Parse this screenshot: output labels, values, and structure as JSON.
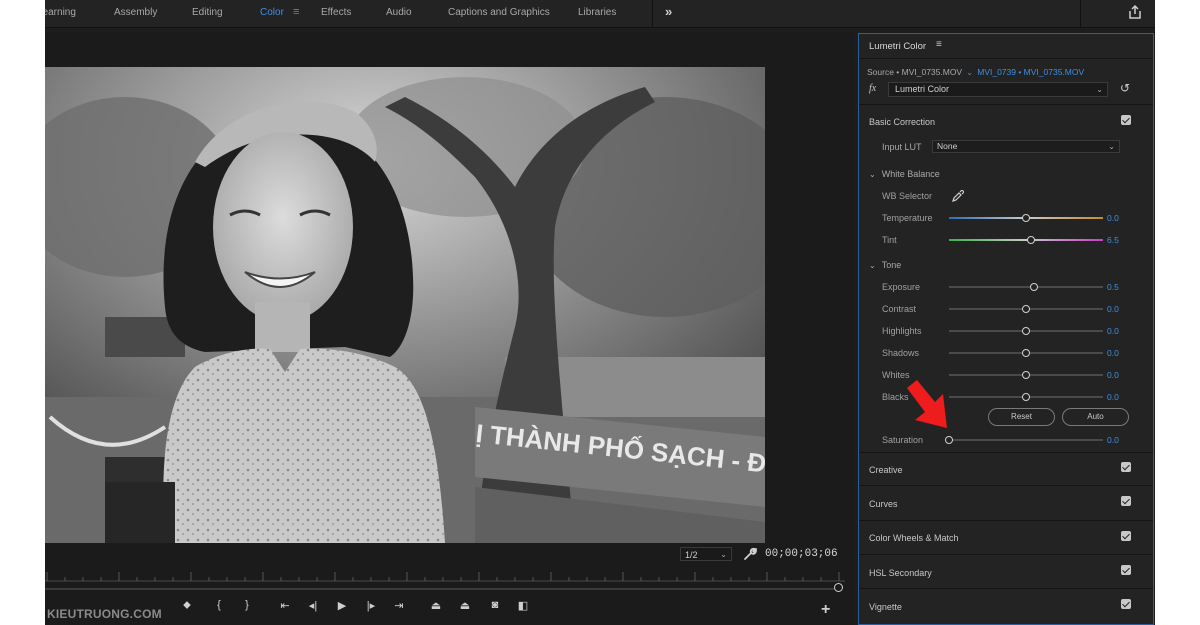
{
  "workspace_tabs": [
    {
      "label": "Learning"
    },
    {
      "label": "Assembly"
    },
    {
      "label": "Editing"
    },
    {
      "label": "Color"
    },
    {
      "label": "Effects"
    },
    {
      "label": "Audio"
    },
    {
      "label": "Captions and Graphics"
    },
    {
      "label": "Libraries"
    }
  ],
  "workspace_menu_glyph": "≡",
  "workspace_more": "»",
  "monitor": {
    "zoom": "1/2",
    "timecode": "00;00;03;06",
    "watermark": "KIEUTRUONG.COM",
    "sign_text": "Ị THÀNH PHỐ SẠCH - ĐẸ",
    "playhead_fraction": 0.99
  },
  "lumetri": {
    "title": "Lumetri Color",
    "menu_glyph": "≡",
    "source_label": "Source • MVI_0735.MOV",
    "sequence_label": "MVI_0739 • MVI_0735.MOV",
    "fx_label": "fx",
    "effect_name": "Lumetri Color",
    "basic_correction": {
      "label": "Basic Correction",
      "input_lut_label": "Input LUT",
      "input_lut_value": "None",
      "white_balance_label": "White Balance",
      "wb_selector_label": "WB Selector",
      "temperature": {
        "label": "Temperature",
        "value": "0.0",
        "min": -100,
        "max": 100
      },
      "tint": {
        "label": "Tint",
        "value": "6.5",
        "min": -100,
        "max": 100
      },
      "tone_label": "Tone",
      "exposure": {
        "label": "Exposure",
        "value": "0.5",
        "min": -5,
        "max": 5
      },
      "contrast": {
        "label": "Contrast",
        "value": "0.0",
        "min": -100,
        "max": 100
      },
      "highlights": {
        "label": "Highlights",
        "value": "0.0",
        "min": -100,
        "max": 100
      },
      "shadows": {
        "label": "Shadows",
        "value": "0.0",
        "min": -100,
        "max": 100
      },
      "whites": {
        "label": "Whites",
        "value": "0.0",
        "min": -100,
        "max": 100
      },
      "blacks": {
        "label": "Blacks",
        "value": "0.0",
        "min": -100,
        "max": 100
      },
      "reset_label": "Reset",
      "auto_label": "Auto",
      "saturation": {
        "label": "Saturation",
        "value": "0.0",
        "min": 0,
        "max": 200
      }
    },
    "sections": [
      {
        "label": "Creative",
        "enabled": true
      },
      {
        "label": "Curves",
        "enabled": true
      },
      {
        "label": "Color Wheels & Match",
        "enabled": true
      },
      {
        "label": "HSL Secondary",
        "enabled": true
      },
      {
        "label": "Vignette",
        "enabled": true
      }
    ]
  },
  "colors": {
    "accent": "#3d8fe0",
    "panel_bg": "#232323",
    "annotation_arrow": "#ee1c1c"
  }
}
